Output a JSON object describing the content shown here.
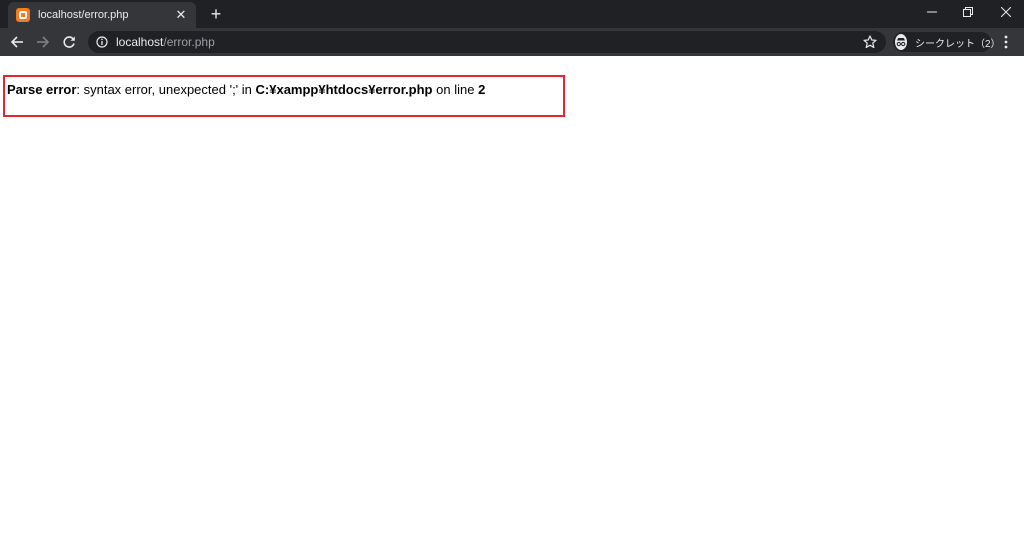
{
  "browser": {
    "tab": {
      "title": "localhost/error.php",
      "close_glyph": "✕",
      "favicon_color": "#f47b20"
    },
    "new_tab_glyph": "+",
    "address": {
      "host": "localhost",
      "path": "/error.php"
    },
    "incognito_label": "シークレット（2）",
    "icons": {
      "back": "back-arrow-icon",
      "forward": "forward-arrow-icon",
      "reload": "reload-icon",
      "site_info": "info-icon",
      "bookmark": "star-icon",
      "menu": "kebab-menu-icon",
      "incognito": "incognito-icon"
    }
  },
  "page": {
    "error": {
      "label": "Parse error",
      "message_before_file": ": syntax error, unexpected ';' in ",
      "file": "C:¥xampp¥htdocs¥error.php",
      "message_before_line": " on line ",
      "line": "2"
    },
    "highlight_color": "#e3262f"
  }
}
